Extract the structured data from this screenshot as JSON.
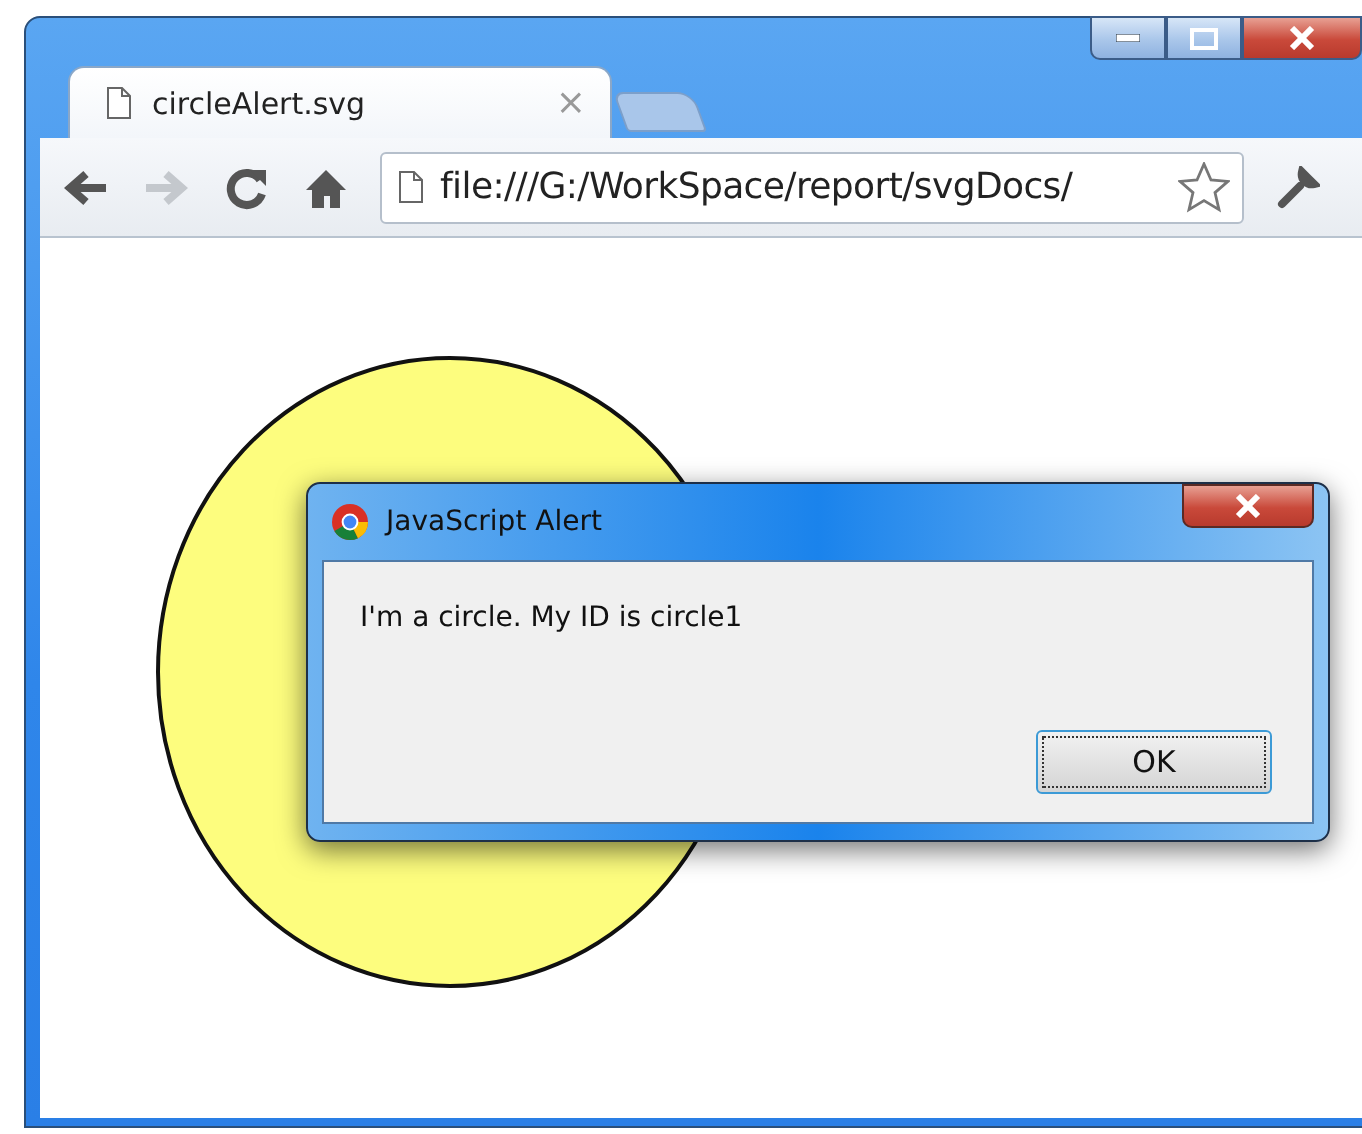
{
  "window": {
    "controls": [
      {
        "kind": "minimize"
      },
      {
        "kind": "maximize"
      },
      {
        "kind": "close"
      }
    ]
  },
  "tabs": [
    {
      "label": "circleAlert.svg",
      "selected": true,
      "close": "×"
    }
  ],
  "toolbar": {
    "back_disabled": false,
    "forward_disabled": true,
    "address": "file:///G:/WorkSpace/report/svgDocs/"
  },
  "page": {
    "shapes": [
      {
        "kind": "circle"
      }
    ]
  },
  "dialog": {
    "title": "JavaScript Alert",
    "message": "I'm a circle. My ID is circle1",
    "buttons": [
      {
        "label": "OK",
        "focused": true
      }
    ]
  }
}
